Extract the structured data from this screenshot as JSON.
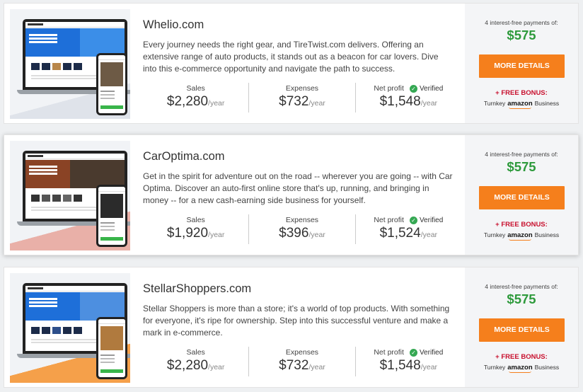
{
  "colors": {
    "accent": "#f57f1c",
    "price_green": "#2e9a3c",
    "bonus_red": "#c8102e",
    "verified_green": "#35a853"
  },
  "listings": [
    {
      "title": "Whelio.com",
      "description": "Every journey needs the right gear, and TireTwist.com delivers. Offering an extensive range of auto products, it stands out as a beacon for car lovers. Dive into this e-commerce opportunity and navigate the path to success.",
      "sales_label": "Sales",
      "sales_value": "$2,280",
      "expenses_label": "Expenses",
      "expenses_value": "$732",
      "net_label": "Net profit",
      "net_value": "$1,548",
      "verified": "Verified",
      "unit": "/year",
      "payments_label": "4 interest-free payments of:",
      "price": "$575",
      "button": "MORE DETAILS",
      "bonus": "+ FREE BONUS:",
      "turnkey": "Turnkey",
      "amazon": "amazon",
      "business": "Business"
    },
    {
      "title": "CarOptima.com",
      "description": "Get in the spirit for adventure out on the road -- wherever you are going -- with Car Optima. Discover an auto-first online store that's up, running, and bringing in money -- for a new cash-earning side business for yourself.",
      "sales_label": "Sales",
      "sales_value": "$1,920",
      "expenses_label": "Expenses",
      "expenses_value": "$396",
      "net_label": "Net profit",
      "net_value": "$1,524",
      "verified": "Verified",
      "unit": "/year",
      "payments_label": "4 interest-free payments of:",
      "price": "$575",
      "button": "MORE DETAILS",
      "bonus": "+ FREE BONUS:",
      "turnkey": "Turnkey",
      "amazon": "amazon",
      "business": "Business"
    },
    {
      "title": "StellarShoppers.com",
      "description": "Stellar Shoppers is more than a store; it's a world of top products. With something for everyone, it's ripe for ownership. Step into this successful venture and make a mark in e-commerce.",
      "sales_label": "Sales",
      "sales_value": "$2,280",
      "expenses_label": "Expenses",
      "expenses_value": "$732",
      "net_label": "Net profit",
      "net_value": "$1,548",
      "verified": "Verified",
      "unit": "/year",
      "payments_label": "4 interest-free payments of:",
      "price": "$575",
      "button": "MORE DETAILS",
      "bonus": "+ FREE BONUS:",
      "turnkey": "Turnkey",
      "amazon": "amazon",
      "business": "Business"
    }
  ]
}
